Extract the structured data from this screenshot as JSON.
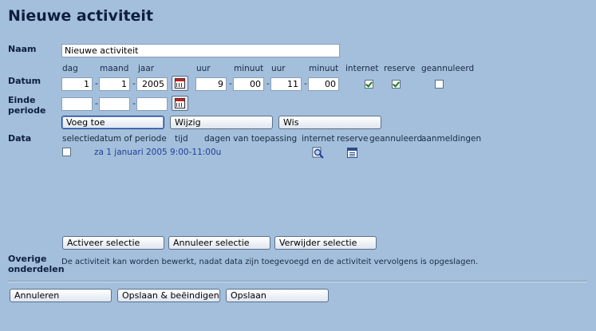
{
  "page": {
    "title": "Nieuwe activiteit"
  },
  "naam": {
    "label": "Naam",
    "value": "Nieuwe activiteit"
  },
  "datum": {
    "label": "Datum",
    "headers": {
      "dag": "dag",
      "maand": "maand",
      "jaar": "jaar",
      "uur1": "uur",
      "minuut1": "minuut",
      "uur2": "uur",
      "minuut2": "minuut",
      "internet": "internet",
      "reserve": "reserve",
      "geannuleerd": "geannuleerd"
    },
    "dag": "1",
    "maand": "1",
    "jaar": "2005",
    "start_uur": "9",
    "start_minuut": "00",
    "eind_uur": "11",
    "eind_minuut": "00",
    "internet_checked": true,
    "reserve_checked": true,
    "geannuleerd_checked": false
  },
  "einde_periode": {
    "label_line1": "Einde",
    "label_line2": "periode",
    "dag": "",
    "maand": "",
    "jaar": ""
  },
  "date_buttons": {
    "add": "Voeg toe",
    "edit": "Wijzig",
    "delete": "Wis"
  },
  "data_section": {
    "label": "Data",
    "columns": {
      "selectie": "selectie",
      "datum": "datum of periode",
      "tijd": "tijd",
      "dagen": "dagen van toepassing",
      "internet": "internet",
      "reserve": "reserve",
      "geannuleerd": "geannuleerd",
      "aanmeldingen": "aanmeldingen"
    },
    "rows": [
      {
        "text": "za 1 januari 2005 9:00-11:00u",
        "selected": false,
        "internet_icon": "search-icon",
        "reserve_icon": "list-icon"
      }
    ]
  },
  "selection_buttons": {
    "activate": "Activeer selectie",
    "cancel": "Annuleer selectie",
    "remove": "Verwijder selectie"
  },
  "other": {
    "label_line1": "Overige",
    "label_line2": "onderdelen",
    "text": "De activiteit kan worden bewerkt, nadat data zijn toegevoegd en de activiteit vervolgens is opgeslagen."
  },
  "footer": {
    "cancel": "Annuleren",
    "save_close": "Opslaan & beëindigen",
    "save": "Opslaan"
  },
  "colors": {
    "background": "#a3bfdb",
    "title": "#0d1f3c",
    "link": "#1f3f9a"
  }
}
